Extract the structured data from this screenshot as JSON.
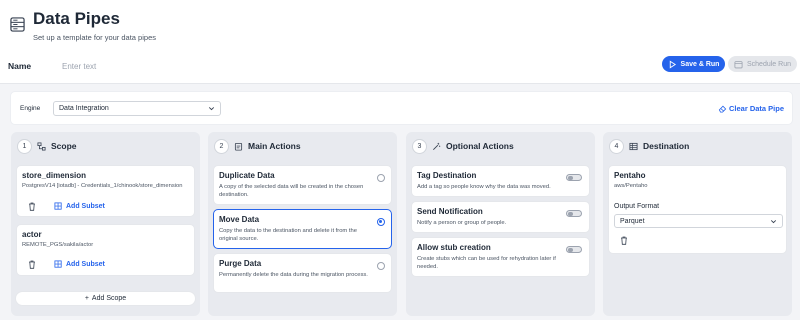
{
  "header": {
    "title": "Data Pipes",
    "subtitle": "Set up a template for your data pipes",
    "icon": "server-rack-icon"
  },
  "name_field": {
    "label": "Name",
    "placeholder": "Enter text",
    "value": ""
  },
  "actions": {
    "save_run_label": "Save & Run",
    "schedule_run_label": "Schedule Run"
  },
  "engine": {
    "label": "Engine",
    "value": "Data Integration",
    "clear_label": "Clear Data Pipe"
  },
  "columns": {
    "scope": {
      "number": "1",
      "title": "Scope",
      "items": [
        {
          "title": "store_dimension",
          "subtitle": "PostgresV14 [iotadb] - Credentials_1/chinook/store_dimension",
          "add_subset": "Add Subset"
        },
        {
          "title": "actor",
          "subtitle": "REMOTE_PGS/sakila/actor",
          "add_subset": "Add Subset"
        }
      ],
      "add_label": "Add Scope"
    },
    "main": {
      "number": "2",
      "title": "Main Actions",
      "items": [
        {
          "title": "Duplicate Data",
          "desc": "A copy of the selected data will be created in the chosen destination.",
          "selected": false
        },
        {
          "title": "Move Data",
          "desc": "Copy the data to the destination and delete it from the original source.",
          "selected": true
        },
        {
          "title": "Purge Data",
          "desc": "Permanently delete the data during the migration process.",
          "selected": false
        }
      ]
    },
    "optional": {
      "number": "3",
      "title": "Optional Actions",
      "items": [
        {
          "title": "Tag Destination",
          "desc": "Add a tag so people know why the data was moved.",
          "enabled": false
        },
        {
          "title": "Send Notification",
          "desc": "Notify a person or group of people.",
          "enabled": false
        },
        {
          "title": "Allow stub creation",
          "desc": "Create stubs which can be used for rehydration later if needed.",
          "enabled": false
        }
      ]
    },
    "destination": {
      "number": "4",
      "title": "Destination",
      "card": {
        "title": "Pentaho",
        "subtitle": "aws/Pentaho",
        "format_label": "Output Format",
        "format_value": "Parquet"
      }
    }
  },
  "colors": {
    "accent": "#2563eb",
    "column_bg": "#e8eaef",
    "page_bg": "#f3f4f7"
  }
}
